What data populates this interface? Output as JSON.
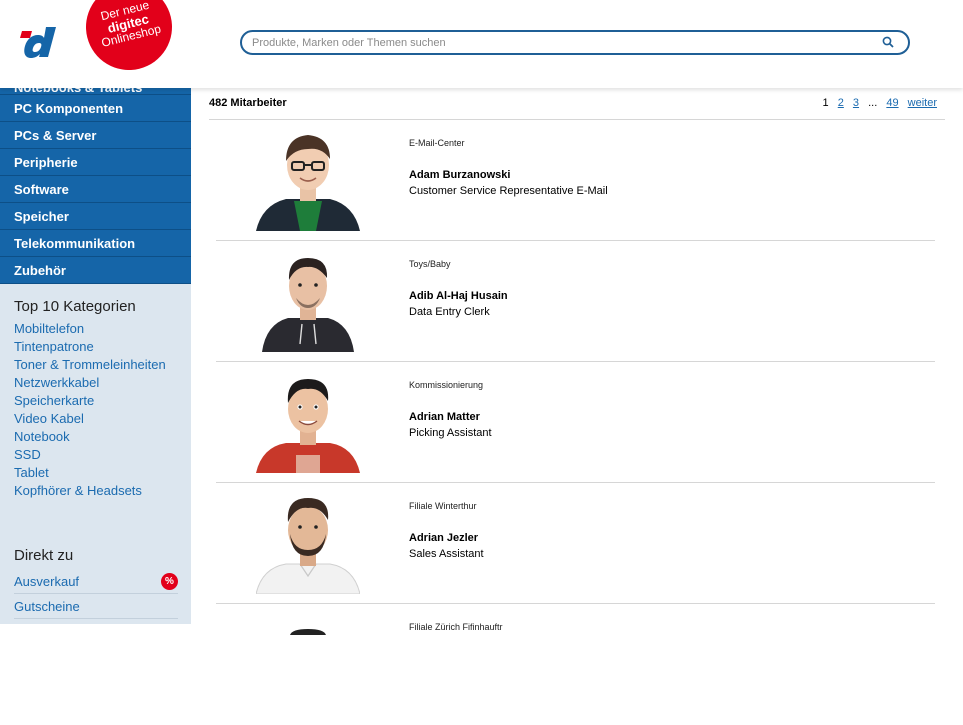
{
  "header": {
    "badge_line1": "Der neue",
    "badge_line2": "digitec",
    "badge_line3": "Onlineshop",
    "search_placeholder": "Produkte, Marken oder Themen suchen",
    "brand_colors": {
      "blue": "#1565a8",
      "red": "#e2001a"
    }
  },
  "sidebar": {
    "categories": [
      "Notebooks & Tablets",
      "PC Komponenten",
      "PCs & Server",
      "Peripherie",
      "Software",
      "Speicher",
      "Telekommunikation",
      "Zubehör"
    ],
    "top10_title": "Top 10 Kategorien",
    "top10": [
      "Mobiltelefon",
      "Tintenpatrone",
      "Toner & Trommeleinheiten",
      "Netzwerkkabel",
      "Speicherkarte",
      "Video Kabel",
      "Notebook",
      "SSD",
      "Tablet",
      "Kopfhörer & Headsets"
    ],
    "direkt_title": "Direkt zu",
    "direkt": [
      {
        "label": "Ausverkauf",
        "badge": "%"
      },
      {
        "label": "Gutscheine",
        "badge": ""
      }
    ]
  },
  "main": {
    "count_label": "482 Mitarbeiter",
    "pager": {
      "current": "1",
      "pages": [
        "2",
        "3"
      ],
      "ellipsis": "...",
      "last": "49",
      "next": "weiter"
    },
    "people": [
      {
        "dept": "E-Mail-Center",
        "name": "Adam Burzanowski",
        "role": "Customer Service Representative E-Mail",
        "shirt": "#1e7d3a",
        "jacket": "#1f2a36"
      },
      {
        "dept": "Toys/Baby",
        "name": "Adib Al-Haj Husain",
        "role": "Data Entry Clerk",
        "shirt": "#1f1f24",
        "jacket": "#2a2a30"
      },
      {
        "dept": "Kommissionierung",
        "name": "Adrian Matter",
        "role": "Picking Assistant",
        "shirt": "#c8382a",
        "jacket": "#c8382a"
      },
      {
        "dept": "Filiale Winterthur",
        "name": "Adrian Jezler",
        "role": "Sales Assistant",
        "shirt": "#f2f2f2",
        "jacket": "#f2f2f2"
      },
      {
        "dept": "Filiale Zürich Fifinhauftr",
        "name": "",
        "role": "",
        "shirt": "#222",
        "jacket": "#222"
      }
    ]
  }
}
